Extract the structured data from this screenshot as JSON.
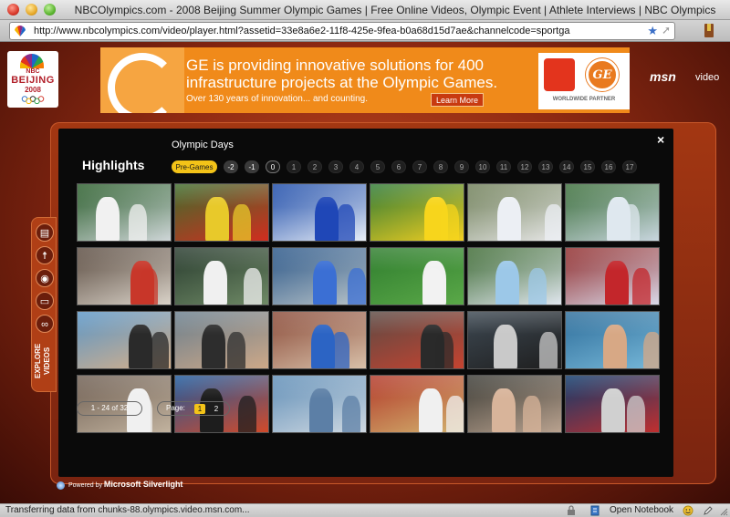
{
  "window": {
    "title": "NBCOlympics.com - 2008 Beijing Summer Olympic Games | Free Online Videos, Olympic Event | Athlete Interviews | NBC Olympics"
  },
  "address_bar": {
    "url": "http://www.nbcolympics.com/video/player.html?assetid=33e8a6e2-11f8-425e-9fea-b0a68d15d7ae&channelcode=sportga"
  },
  "logo": {
    "network": "NBC",
    "city": "BEIJING",
    "year": "2008"
  },
  "ad": {
    "headline": "GE is providing innovative solutions for 400 infrastructure projects at the Olympic Games.",
    "subline": "Over 130 years of innovation... and counting.",
    "button": "Learn More",
    "brand": "GE",
    "partner_text": "WORLDWIDE PARTNER"
  },
  "msn": {
    "logo": "msn",
    "label": "video"
  },
  "explore": {
    "label": "EXPLORE VIDEOS",
    "icons": [
      "newspaper-icon",
      "runner-icon",
      "eye-icon",
      "tv-icon",
      "rings-icon"
    ]
  },
  "player": {
    "title": "Highlights",
    "days_label": "Olympic Days",
    "close_glyph": "×",
    "days": [
      "Pre-Games",
      "-2",
      "-1",
      "0",
      "1",
      "2",
      "3",
      "4",
      "5",
      "6",
      "7",
      "8",
      "9",
      "10",
      "11",
      "12",
      "13",
      "14",
      "15",
      "16",
      "17"
    ],
    "selected_day": "Pre-Games",
    "thumbnails": [
      {
        "bg": [
          "#2a5d2b",
          "#cfd6d8"
        ],
        "fig": "#f1f1f1"
      },
      {
        "bg": [
          "#3f6d2c",
          "#d12d1f"
        ],
        "fig": "#e8c92a"
      },
      {
        "bg": [
          "#1b4aa8",
          "#e8eef7"
        ],
        "fig": "#1f47b7"
      },
      {
        "bg": [
          "#2f7a36",
          "#f4cf20"
        ],
        "fig": "#f7d51c"
      },
      {
        "bg": [
          "#6f7f58",
          "#e6e6e6"
        ],
        "fig": "#eceff4"
      },
      {
        "bg": [
          "#3b6e3a",
          "#c9d6df"
        ],
        "fig": "#dfe8ef"
      },
      {
        "bg": [
          "#5a4b40",
          "#d9d2c8"
        ],
        "fig": "#c8372a"
      },
      {
        "bg": [
          "#283b2e",
          "#6f8a66"
        ],
        "fig": "#f0f0f0"
      },
      {
        "bg": [
          "#2a5688",
          "#b8c3c8"
        ],
        "fig": "#3b6fd4"
      },
      {
        "bg": [
          "#2f7d2e",
          "#5aa848"
        ],
        "fig": "#f1f1f1"
      },
      {
        "bg": [
          "#3d6a33",
          "#e0e6ee"
        ],
        "fig": "#9cc8e8"
      },
      {
        "bg": [
          "#8f2b2b",
          "#d9d9e9"
        ],
        "fig": "#c3262b"
      },
      {
        "bg": [
          "#5b96c7",
          "#d6b08a"
        ],
        "fig": "#2a2a2a"
      },
      {
        "bg": [
          "#6a7f8e",
          "#cda888"
        ],
        "fig": "#2d2d2d"
      },
      {
        "bg": [
          "#8a4b39",
          "#d8c0a9"
        ],
        "fig": "#2c64c4"
      },
      {
        "bg": [
          "#5d4a44",
          "#c64330"
        ],
        "fig": "#2a2a2a"
      },
      {
        "bg": [
          "#3e4953",
          "#1e1e1e"
        ],
        "fig": "#c9c9c9"
      },
      {
        "bg": [
          "#2e6d9a",
          "#76b7d8"
        ],
        "fig": "#d7a885"
      },
      {
        "bg": [
          "#6e5e52",
          "#c2b39f"
        ],
        "fig": "#f0f0f0"
      },
      {
        "bg": [
          "#1d5a9e",
          "#d14a2a"
        ],
        "fig": "#1d1d1d"
      },
      {
        "bg": [
          "#5f8db6",
          "#cfd9e2"
        ],
        "fig": "#5c7fa6"
      },
      {
        "bg": [
          "#b2392a",
          "#d2b26e"
        ],
        "fig": "#f0f0f0"
      },
      {
        "bg": [
          "#3c3c36",
          "#b9a28f"
        ],
        "fig": "#d8b49a"
      },
      {
        "bg": [
          "#0e3b6d",
          "#c02f2f"
        ],
        "fig": "#d0d0d0"
      }
    ],
    "pager_count": "1 - 24 of 32",
    "pager_label": "Page:",
    "pages": [
      "1",
      "2"
    ],
    "current_page": "1"
  },
  "footer": {
    "powered_by": "Powered by",
    "product": "Microsoft Silverlight"
  },
  "status": {
    "text": "Transferring data from chunks-88.olympics.video.msn.com...",
    "notebook": "Open Notebook"
  }
}
